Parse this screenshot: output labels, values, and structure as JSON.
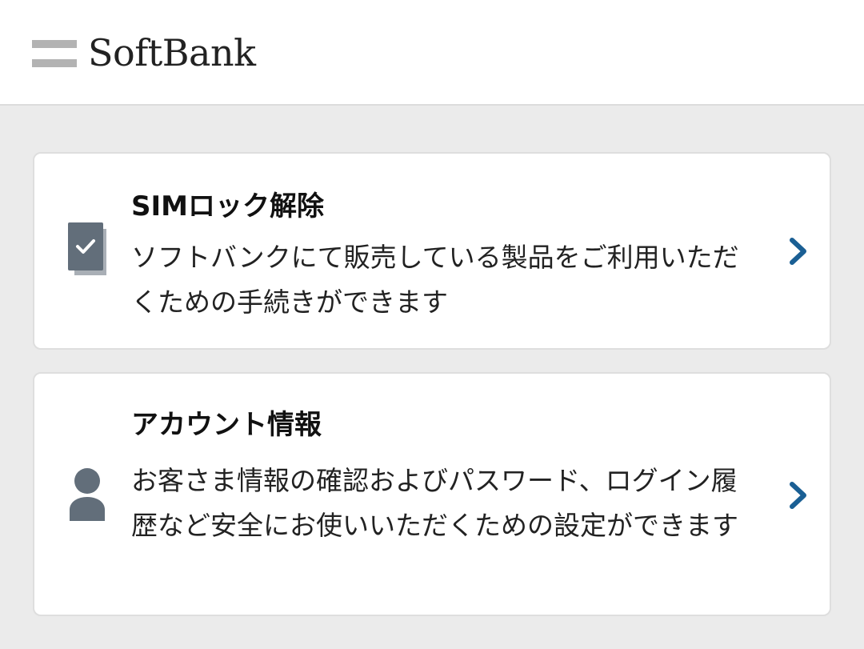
{
  "header": {
    "brand": "SoftBank",
    "logo_icon": "softbank-logo-bars"
  },
  "cards": [
    {
      "id": "sim-unlock",
      "icon": "document-check-icon",
      "title": "SIMロック解除",
      "description": "ソフトバンクにて販売している製品をご利用いただくための手続きができます",
      "arrow_icon": "chevron-right-icon"
    },
    {
      "id": "account-info",
      "icon": "person-icon",
      "title": "アカウント情報",
      "description": "お客さま情報の確認およびパスワード、ログイン履歴など安全にお使いいただくための設定ができます",
      "arrow_icon": "chevron-right-icon"
    }
  ],
  "colors": {
    "background": "#ebebeb",
    "card": "#ffffff",
    "icon": "#626e7a",
    "chevron": "#1a5f94",
    "logo_bars": "#b3b3b3"
  }
}
